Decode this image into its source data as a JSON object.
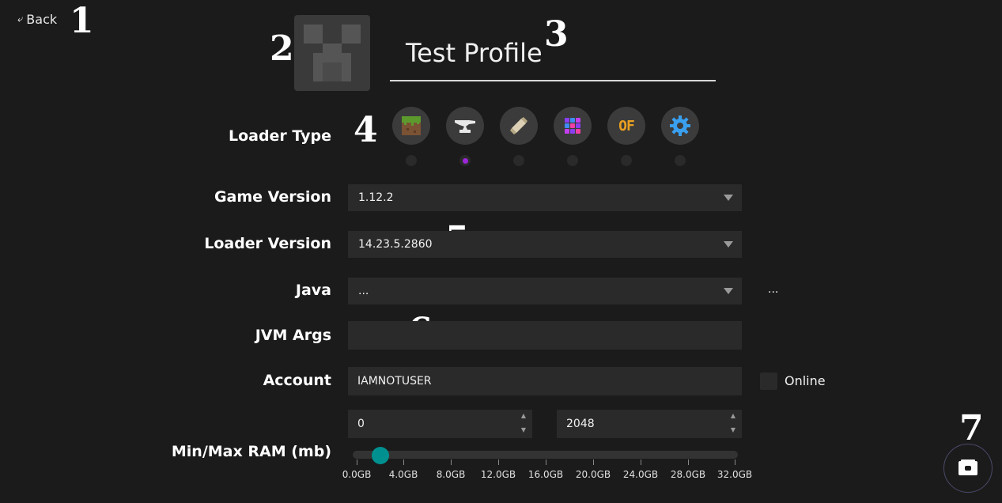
{
  "nav": {
    "back_arrow": "⤶",
    "back_label": "Back"
  },
  "annotations": [
    "1",
    "2",
    "3",
    "4",
    "5",
    "6",
    "7"
  ],
  "profile": {
    "name": "Test Profile"
  },
  "loader": {
    "label": "Loader Type",
    "options": [
      "vanilla-grass-icon",
      "forge-anvil-icon",
      "fabric-scroll-icon",
      "quilt-patchwork-icon",
      "optifine-icon",
      "custom-gear-icon"
    ],
    "optifine_text": "OF",
    "selected_index": 1,
    "accent": "#9c27d8"
  },
  "game_version": {
    "label": "Game Version",
    "value": "1.12.2"
  },
  "loader_version": {
    "label": "Loader Version",
    "value": "14.23.5.2860"
  },
  "java": {
    "label": "Java",
    "value": "...",
    "browse_label": "..."
  },
  "jvm_args": {
    "label": "JVM Args",
    "value": ""
  },
  "account": {
    "label": "Account",
    "value": "IAMNOTUSER",
    "online_label": "Online"
  },
  "ram": {
    "label": "Min/Max RAM (mb)",
    "min": "0",
    "max": "2048",
    "slider_fraction": 0.0625,
    "ticks": [
      "0.0GB",
      "4.0GB",
      "8.0GB",
      "12.0GB",
      "16.0GB",
      "20.0GB",
      "24.0GB",
      "28.0GB",
      "32.0GB"
    ],
    "thumb_color": "#009090"
  },
  "fab": {
    "icon": "save-icon"
  }
}
